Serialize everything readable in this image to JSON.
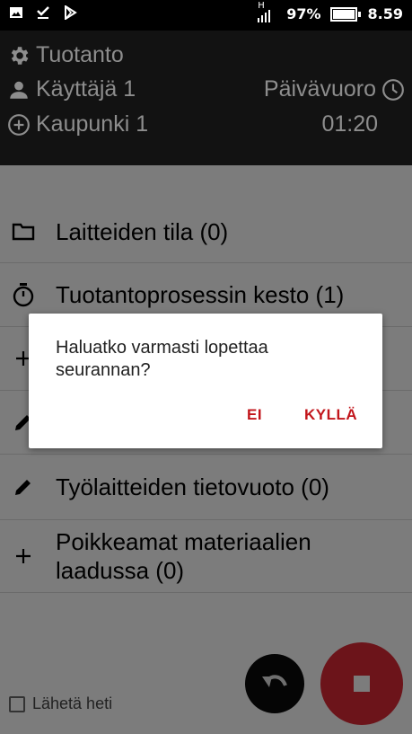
{
  "status_bar": {
    "network_label": "H",
    "battery_percent": "97%",
    "battery_level": 0.97,
    "time": "8.59",
    "icons": [
      "gallery-icon",
      "download-icon",
      "play-store-icon",
      "signal-icon",
      "battery-icon"
    ]
  },
  "header": {
    "department": "Tuotanto",
    "user": "Käyttäjä 1",
    "city": "Kaupunki 1",
    "shift": "Päivävuoro",
    "elapsed": "01:20"
  },
  "list": {
    "items": [
      {
        "label": "Laitteiden tila (0)",
        "icon": "folder-icon"
      },
      {
        "label": "Tuotantoprosessin kesto (1)",
        "icon": "stopwatch-icon"
      },
      {
        "label": "",
        "icon": "plus-icon"
      },
      {
        "label": "",
        "icon": "pencil-icon"
      },
      {
        "label": "Työlaitteiden tietovuoto (0)",
        "icon": "pencil-icon"
      },
      {
        "label_line1": "Poikkeamat materiaalien",
        "label_line2": "laadussa (0)",
        "icon": "plus-icon"
      }
    ]
  },
  "dialog": {
    "message_line1": "Haluatko varmasti lopettaa",
    "message_line2": "seurannan?",
    "no_label": "EI",
    "yes_label": "KYLLÄ"
  },
  "footer": {
    "send_now_label": "Lähetä heti"
  },
  "colors": {
    "accent": "#c2151b",
    "stop_button": "#6c141a",
    "header_bg": "#121212",
    "scrim": "#7c7c7c"
  }
}
